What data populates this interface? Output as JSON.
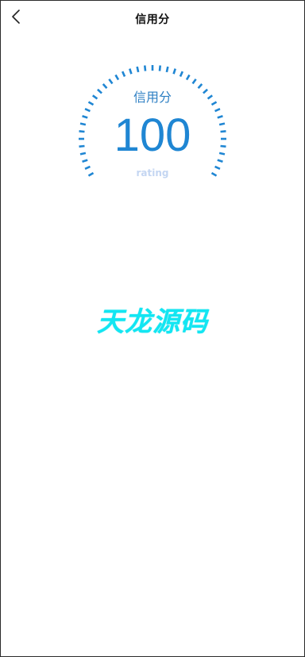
{
  "header": {
    "title": "信用分",
    "back_icon": "chevron-left-icon"
  },
  "gauge": {
    "label": "信用分",
    "value": "100",
    "caption": "rating",
    "level_fraction": 1.0,
    "colors": {
      "ticks": "#1f86d3",
      "value": "#1f86d3",
      "caption": "#c4d6f2"
    }
  },
  "watermark": {
    "text": "天龙源码",
    "color": "#12e6f2"
  }
}
